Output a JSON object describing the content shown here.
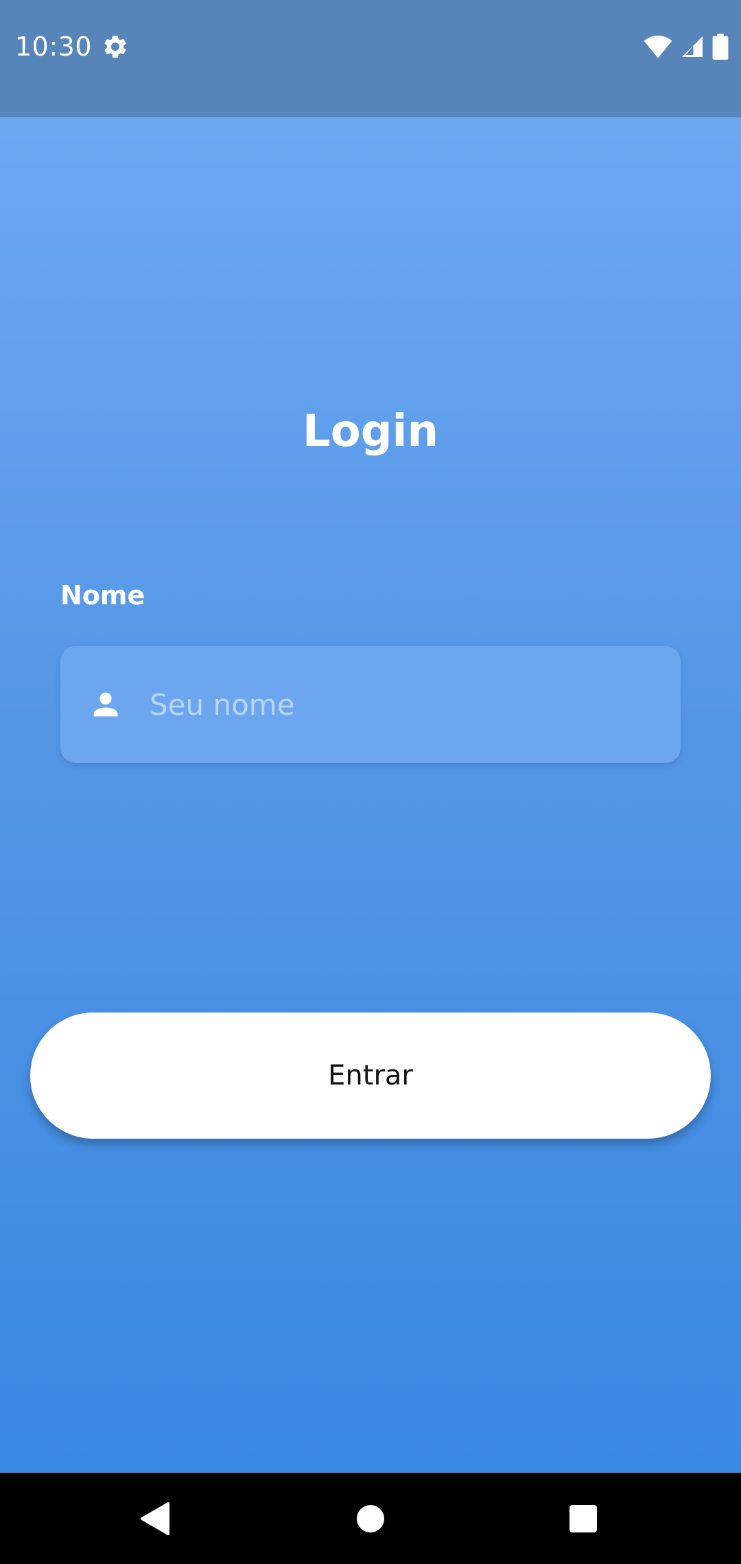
{
  "status_bar": {
    "time": "10:30",
    "icons": [
      "settings-gear-icon",
      "wifi-icon",
      "cellular-signal-icon",
      "battery-icon"
    ],
    "background_color": "#5785ba"
  },
  "login": {
    "title": "Login",
    "name_field": {
      "label": "Nome",
      "placeholder": "Seu nome",
      "value": "",
      "icon": "person-icon"
    },
    "submit_label": "Entrar"
  },
  "colors": {
    "gradient_top": "#6aa8f2",
    "gradient_bottom": "#3a89e3",
    "input_background": "#6ca6ef",
    "button_background": "#ffffff"
  },
  "navigation_bar": {
    "buttons": [
      "back-icon",
      "home-icon",
      "recents-icon"
    ]
  }
}
